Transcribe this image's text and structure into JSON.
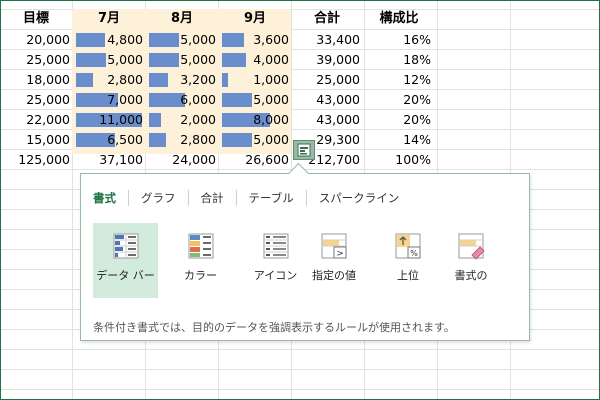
{
  "sheet": {
    "headers": [
      "目標",
      "7月",
      "8月",
      "9月",
      "合計",
      "構成比"
    ],
    "rows": [
      {
        "target": "20,000",
        "jul": "4,800",
        "aug": "5,000",
        "sep": "3,600",
        "total": "33,400",
        "share": "16%"
      },
      {
        "target": "25,000",
        "jul": "5,000",
        "aug": "5,000",
        "sep": "4,000",
        "total": "39,000",
        "share": "18%"
      },
      {
        "target": "18,000",
        "jul": "2,800",
        "aug": "3,200",
        "sep": "1,000",
        "total": "25,000",
        "share": "12%"
      },
      {
        "target": "25,000",
        "jul": "7,000",
        "aug": "6,000",
        "sep": "5,000",
        "total": "43,000",
        "share": "20%"
      },
      {
        "target": "22,000",
        "jul": "11,000",
        "aug": "2,000",
        "sep": "8,000",
        "total": "43,000",
        "share": "20%"
      },
      {
        "target": "15,000",
        "jul": "6,500",
        "aug": "2,800",
        "sep": "5,000",
        "total": "29,300",
        "share": "14%"
      }
    ],
    "totals": {
      "target": "125,000",
      "jul": "37,100",
      "aug": "24,000",
      "sep": "26,600",
      "total": "212,700",
      "share": "100%"
    },
    "data_bar_values": {
      "jul": [
        4800,
        5000,
        2800,
        7000,
        11000,
        6500
      ],
      "aug": [
        5000,
        5000,
        3200,
        6000,
        2000,
        2800
      ],
      "sep": [
        3600,
        4000,
        1000,
        5000,
        8000,
        5000
      ]
    }
  },
  "quick_analysis": {
    "button_icon": "quick-analysis-icon",
    "tabs": [
      "書式",
      "グラフ",
      "合計",
      "テーブル",
      "スパークライン"
    ],
    "active_tab": "書式",
    "options": [
      {
        "label": "データ バー",
        "icon": "data-bar-icon"
      },
      {
        "label": "カラー",
        "icon": "color-scale-icon"
      },
      {
        "label": "アイコン",
        "icon": "icon-set-icon"
      },
      {
        "label": "指定の値",
        "icon": "greater-than-icon"
      },
      {
        "label": "上位",
        "icon": "top-percent-icon"
      },
      {
        "label": "書式の",
        "icon": "clear-format-icon"
      }
    ],
    "description": "条件付き書式では、目的のデータを強調表示するルールが使用されます。"
  },
  "colors": {
    "accent": "#217346",
    "data_bar": "#6a8ecb",
    "selection": "#fdf2d9",
    "active_tile": "#d3ebdc"
  }
}
